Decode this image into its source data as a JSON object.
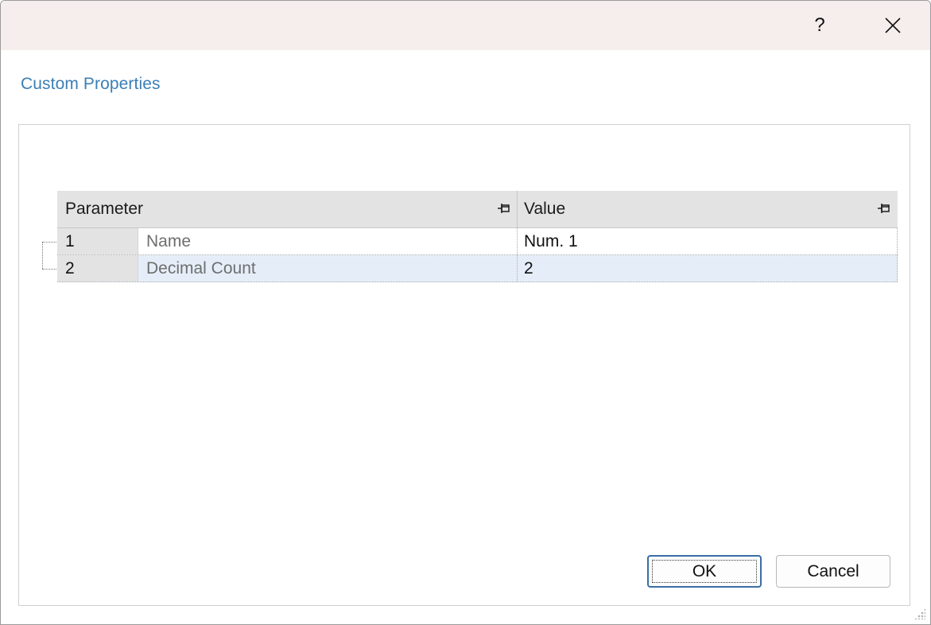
{
  "window": {
    "help_label": "?",
    "close_icon": "close-icon"
  },
  "section": {
    "title": "Custom Properties"
  },
  "grid": {
    "columns": [
      {
        "label": "Parameter",
        "pin_icon": "pin-icon"
      },
      {
        "label": "Value",
        "pin_icon": "pin-icon"
      }
    ],
    "rows": [
      {
        "index": "1",
        "parameter": "Name",
        "value": "Num. 1"
      },
      {
        "index": "2",
        "parameter": "Decimal Count",
        "value": "2",
        "selected": true
      }
    ]
  },
  "buttons": {
    "ok": "OK",
    "cancel": "Cancel"
  },
  "colors": {
    "title_bar": "#f6eeec",
    "section_title": "#3b7fb5",
    "selected_row": "#e5eef8",
    "header_bg": "#e3e3e3"
  }
}
